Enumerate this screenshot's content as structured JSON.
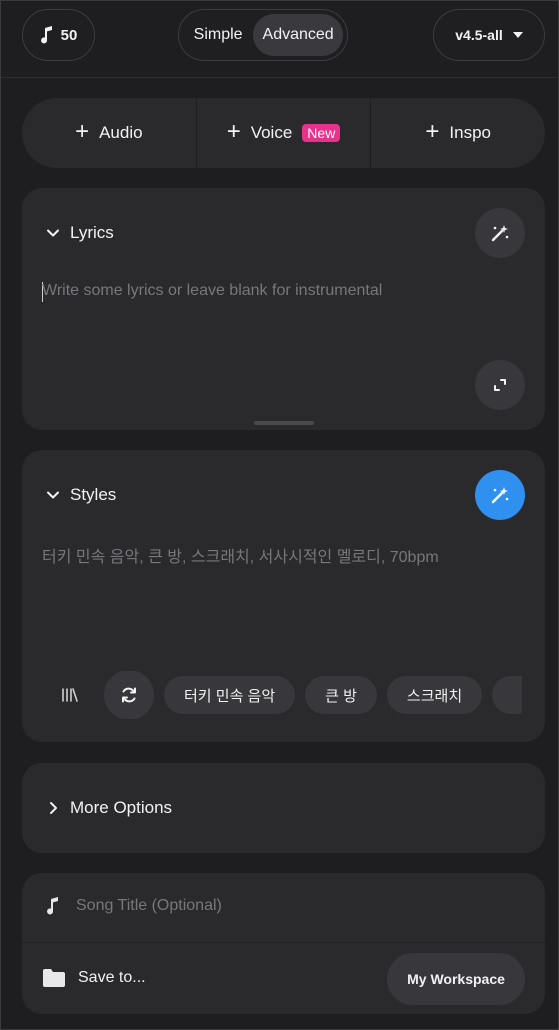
{
  "header": {
    "credits": "50",
    "mode_simple": "Simple",
    "mode_advanced": "Advanced",
    "version": "v4.5-all"
  },
  "add_row": {
    "audio": "Audio",
    "voice": "Voice",
    "voice_badge": "New",
    "inspo": "Inspo"
  },
  "lyrics": {
    "title": "Lyrics",
    "placeholder": "Write some lyrics or leave blank for instrumental"
  },
  "styles": {
    "title": "Styles",
    "placeholder": "터키 민속 음악, 큰 방, 스크래치, 서사시적인 멜로디, 70bpm",
    "chips": [
      "터키 민속 음악",
      "큰 방",
      "스크래치"
    ]
  },
  "more_options": {
    "label": "More Options"
  },
  "song": {
    "title_placeholder": "Song Title (Optional)",
    "save_to": "Save to...",
    "workspace": "My Workspace"
  },
  "icons": {
    "credits": "music-note-icon",
    "version": "caret-down-icon",
    "magic": "magic-wand-icon",
    "expand": "expand-icon",
    "library": "library-icon",
    "refresh": "refresh-icon",
    "folder": "folder-icon"
  },
  "colors": {
    "accent_blue": "#3090f0",
    "badge_pink": "#e7328b",
    "card_bg": "#2a2a2d",
    "page_bg": "#1e1e21"
  }
}
